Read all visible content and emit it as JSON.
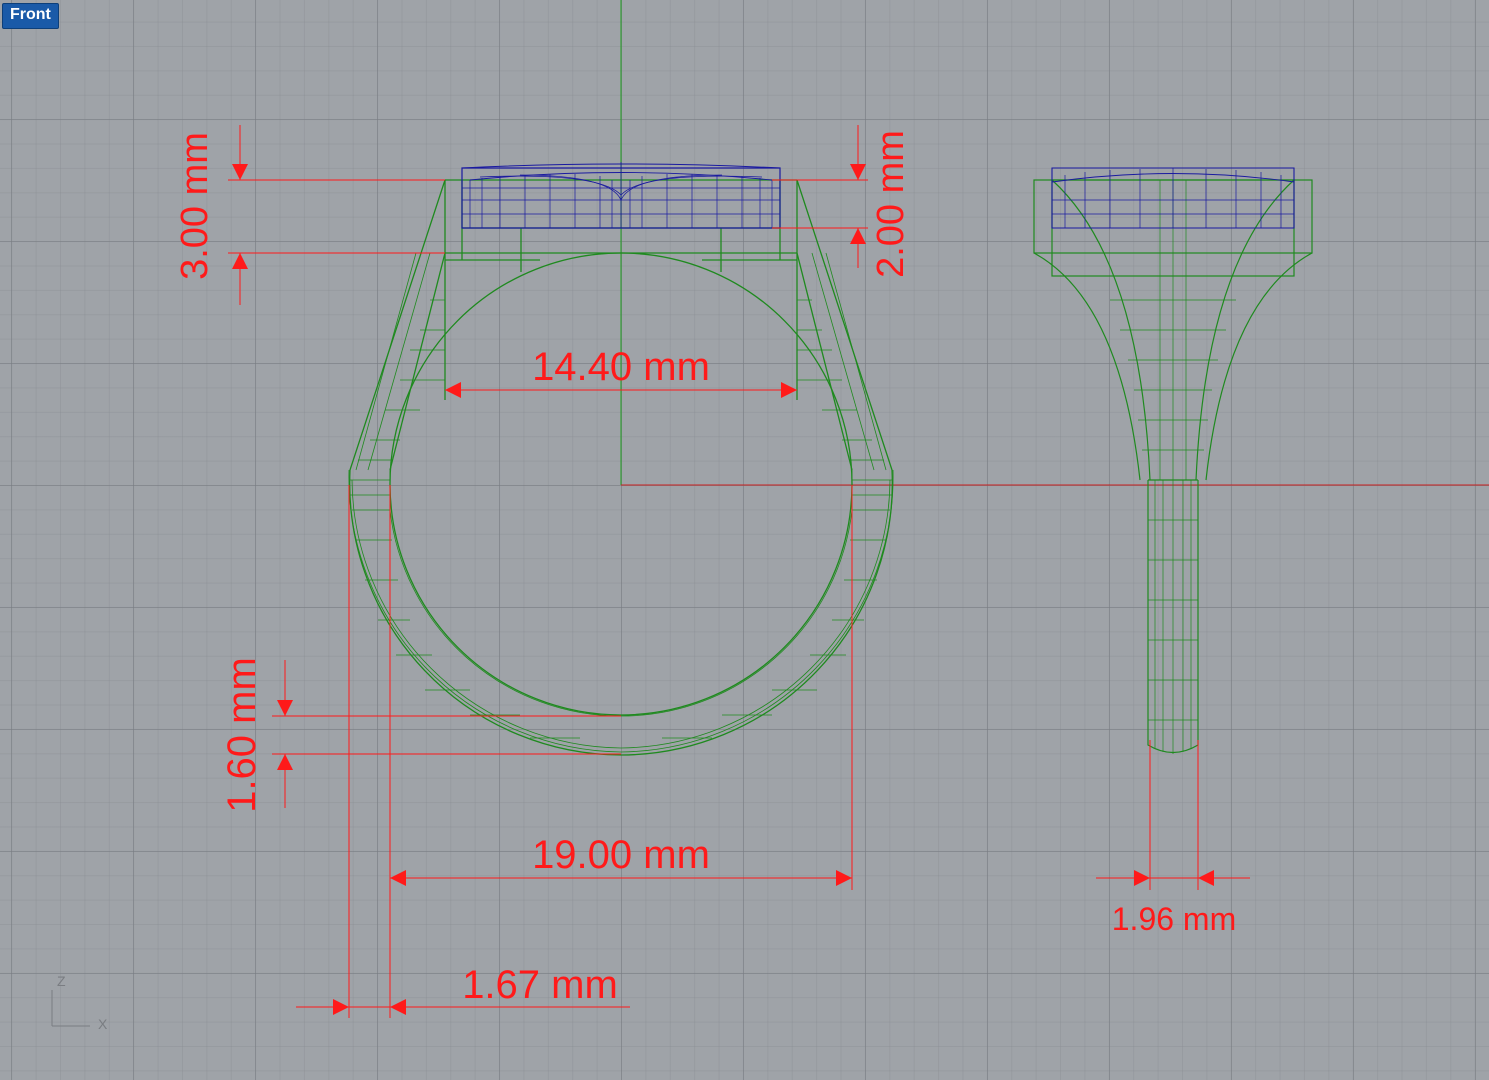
{
  "viewport": {
    "label": "Front"
  },
  "dimensions": {
    "top_height": "3.00 mm",
    "bezel_height": "2.00 mm",
    "inner_width": "14.40 mm",
    "shank_thickness": "1.60 mm",
    "inner_diameter": "19.00 mm",
    "wall_thickness": "1.67 mm",
    "side_width": "1.96 mm"
  },
  "axis_indicator": {
    "vertical": "Z",
    "horizontal": "X"
  },
  "colors": {
    "background": "#9fa3a8",
    "ring_wireframe": "#1f8a1f",
    "stone_wireframe": "#1a1aa0",
    "dimension": "#ff1a1a",
    "world_axis_x": "#c82020",
    "world_axis_z": "#20a020"
  }
}
